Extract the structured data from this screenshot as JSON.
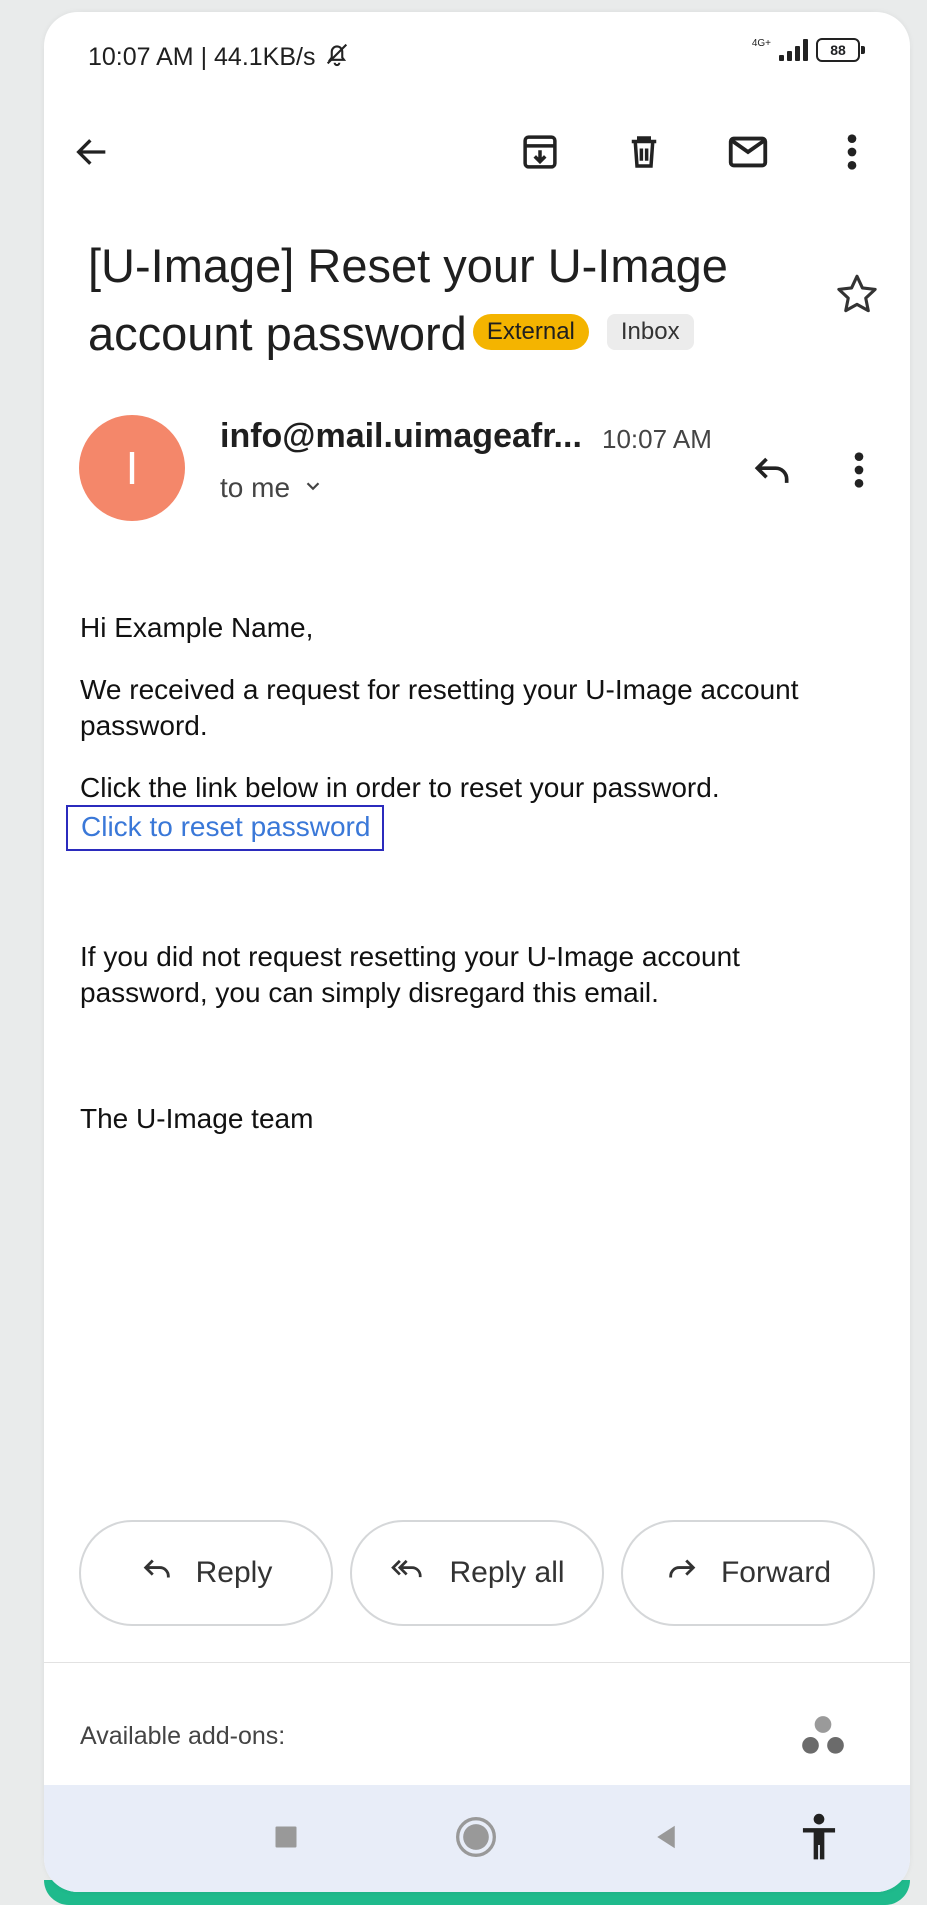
{
  "status_bar": {
    "time_speed": "10:07 AM | 44.1KB/s",
    "network": "4G+",
    "battery": "88"
  },
  "email": {
    "subject": "[U-Image] Reset your U-Image account password",
    "labels": {
      "external": "External",
      "inbox": "Inbox"
    },
    "sender": {
      "avatar_initial": "I",
      "name": "info@mail.uimageafr...",
      "time": "10:07 AM",
      "recipient": "to me"
    },
    "body": {
      "greeting": "Hi Example Name,",
      "paragraph1": "We received a request for resetting your U-Image account password.",
      "paragraph2": "Click the link below in order to reset your password.",
      "link_text": "Click to reset password",
      "paragraph3": "If you did not request resetting your U-Image account password, you can simply disregard this email.",
      "signature": "The U-Image team"
    }
  },
  "actions": {
    "reply": "Reply",
    "reply_all": "Reply all",
    "forward": "Forward"
  },
  "addons": {
    "label": "Available add-ons:"
  },
  "colors": {
    "avatar": "#f4876a",
    "external_badge": "#f4b400",
    "link": "#3a78d8",
    "nav_bar": "#e8edf8",
    "accent_strip": "#1fba8c"
  },
  "icons": {
    "toolbar": [
      "back-arrow-icon",
      "archive-icon",
      "delete-icon",
      "mail-unread-icon",
      "more-vert-icon"
    ],
    "status": [
      "silent-bell-icon",
      "signal-icon",
      "battery-icon"
    ],
    "nav": [
      "recents-square-icon",
      "home-circle-icon",
      "back-triangle-icon",
      "accessibility-icon"
    ]
  }
}
